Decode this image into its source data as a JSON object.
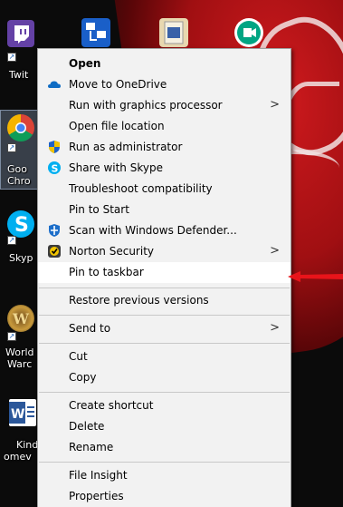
{
  "desktop": {
    "icons": [
      {
        "label": "Twit",
        "icon": "twitch-icon",
        "color": "#6441a5"
      },
      {
        "label": "Goo",
        "label2": "Chro",
        "icon": "chrome-icon"
      },
      {
        "label": "Skyp",
        "icon": "skype-icon",
        "color": "#00aff0"
      },
      {
        "label": "World",
        "label2": "Warc",
        "icon": "world-of-warcraft-icon"
      },
      {
        "label": "Kind",
        "label2": "omev",
        "icon": "word-icon",
        "color": "#2b579a"
      }
    ],
    "top_icons": [
      "network-icon",
      "document-icon",
      "meet-icon"
    ]
  },
  "context_menu": {
    "items": [
      {
        "label": "Open",
        "bold": true
      },
      {
        "label": "Move to OneDrive",
        "icon": "onedrive-icon"
      },
      {
        "label": "Run with graphics processor",
        "submenu": true
      },
      {
        "label": "Open file location"
      },
      {
        "label": "Run as administrator",
        "icon": "uac-shield-icon"
      },
      {
        "label": "Share with Skype",
        "icon": "skype-icon"
      },
      {
        "label": "Troubleshoot compatibility"
      },
      {
        "label": "Pin to Start"
      },
      {
        "label": "Scan with Windows Defender...",
        "icon": "defender-icon"
      },
      {
        "label": "Norton Security",
        "icon": "norton-icon",
        "submenu": true
      },
      {
        "label": "Pin to taskbar",
        "highlighted": true
      },
      {
        "label": "Restore previous versions"
      },
      {
        "label": "Send to",
        "submenu": true
      },
      {
        "label": "Cut"
      },
      {
        "label": "Copy"
      },
      {
        "label": "Create shortcut"
      },
      {
        "label": "Delete"
      },
      {
        "label": "Rename"
      },
      {
        "label": "File Insight"
      },
      {
        "label": "Properties"
      }
    ],
    "submenu_glyph": ">"
  },
  "colors": {
    "highlight": "#ffffff",
    "menu_bg": "#f2f2f2",
    "arrow": "#e8141a",
    "wallpaper_red": "#c8161a"
  }
}
